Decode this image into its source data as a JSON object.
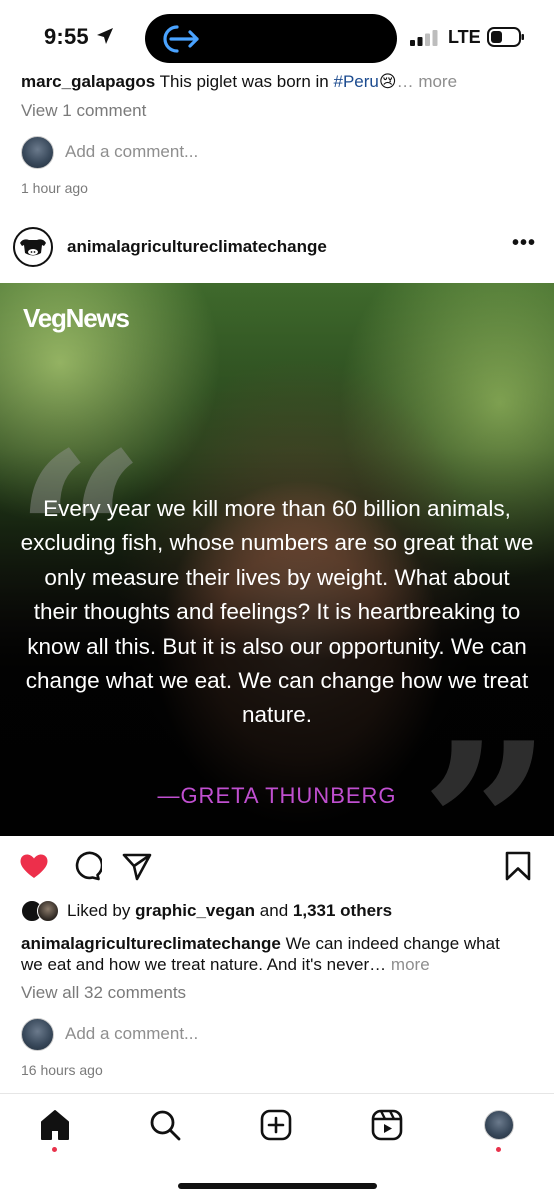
{
  "status_bar": {
    "time": "9:55",
    "network": "LTE",
    "icons": [
      "location-arrow-icon",
      "screen-share-icon",
      "signal-icon",
      "battery-icon"
    ]
  },
  "previous_post": {
    "username": "marc_galapagos",
    "caption_text": "This piglet was born in",
    "hashtag": "#Peru",
    "emoji": "😢",
    "more_label": "… more",
    "view_comments": "View 1 comment",
    "add_comment_placeholder": "Add a comment...",
    "timestamp": "1 hour ago"
  },
  "post": {
    "username": "animalagricultureclimatechange",
    "options_label": "•••",
    "image": {
      "brand": "VegNews",
      "quote": "Every year we kill more than 60 billion animals, excluding fish, whose numbers are so great that we only measure their lives by weight. What about their thoughts and feelings? It is heartbreaking to know all this. But it is also our opportunity. We can change what we eat. We can change how we treat nature.",
      "author": "—GRETA THUNBERG",
      "open_quote_mark": "“",
      "close_quote_mark": "”"
    },
    "actions": {
      "liked": true,
      "like_color": "#ed2f4b"
    },
    "likes": {
      "prefix": "Liked by",
      "liker": "graphic_vegan",
      "connector": "and",
      "others": "1,331 others"
    },
    "caption": {
      "username": "animalagricultureclimatechange",
      "text": "We can indeed change what we eat and how we treat nature. And it's never…",
      "more_label": "more"
    },
    "view_comments": "View all 32 comments",
    "add_comment_placeholder": "Add a comment...",
    "timestamp": "16 hours ago"
  },
  "bottom_nav": {
    "items": [
      "home-icon",
      "search-icon",
      "create-icon",
      "reels-icon",
      "profile-avatar"
    ],
    "active": "home",
    "notification_color": "#e8324b"
  }
}
